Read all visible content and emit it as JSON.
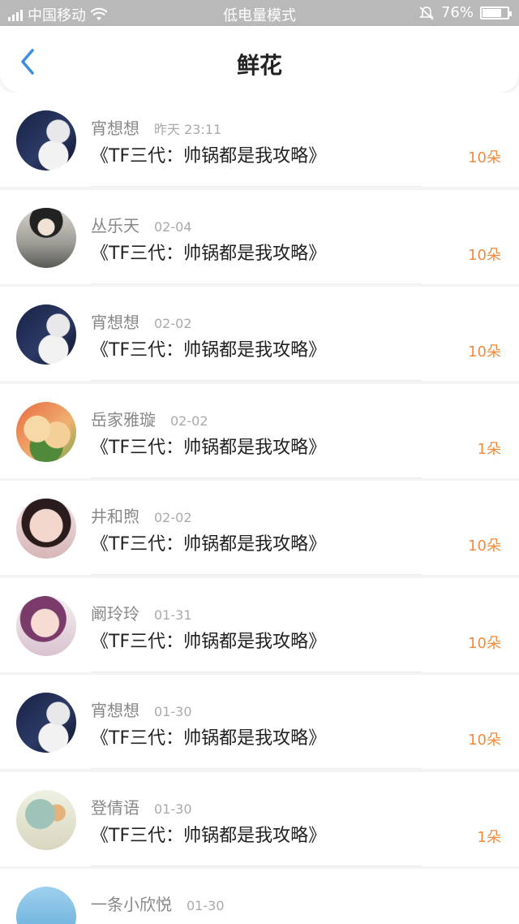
{
  "status_bar": {
    "carrier": "中国移动",
    "mode": "低电量模式",
    "battery": "76%",
    "battery_level": 0.76
  },
  "header": {
    "title": "鲜花",
    "back_icon": "chevron-left-icon"
  },
  "colors": {
    "accent": "#3a8ee6",
    "count": "#f08a3c",
    "status_bar": "#b9b9b9"
  },
  "items": [
    {
      "user": "宵想想",
      "time": "昨天 23:11",
      "book": "《TF三代：帅锅都是我攻略》",
      "count": "10朵",
      "avatar": "avatar-dark"
    },
    {
      "user": "丛乐天",
      "time": "02-04",
      "book": "《TF三代：帅锅都是我攻略》",
      "count": "10朵",
      "avatar": "avatar-fashion"
    },
    {
      "user": "宵想想",
      "time": "02-02",
      "book": "《TF三代：帅锅都是我攻略》",
      "count": "10朵",
      "avatar": "avatar-dark"
    },
    {
      "user": "岳家雅璇",
      "time": "02-02",
      "book": "《TF三代：帅锅都是我攻略》",
      "count": "1朵",
      "avatar": "avatar-food"
    },
    {
      "user": "井和煦",
      "time": "02-02",
      "book": "《TF三代：帅锅都是我攻略》",
      "count": "10朵",
      "avatar": "avatar-girl-pink"
    },
    {
      "user": "阚玲玲",
      "time": "01-31",
      "book": "《TF三代：帅锅都是我攻略》",
      "count": "10朵",
      "avatar": "avatar-girl-purple"
    },
    {
      "user": "宵想想",
      "time": "01-30",
      "book": "《TF三代：帅锅都是我攻略》",
      "count": "10朵",
      "avatar": "avatar-dark"
    },
    {
      "user": "登倩语",
      "time": "01-30",
      "book": "《TF三代：帅锅都是我攻略》",
      "count": "1朵",
      "avatar": "avatar-illustration"
    },
    {
      "user": "一条小欣悦",
      "time": "01-30",
      "book": "",
      "count": "",
      "avatar": "avatar-blue"
    }
  ]
}
